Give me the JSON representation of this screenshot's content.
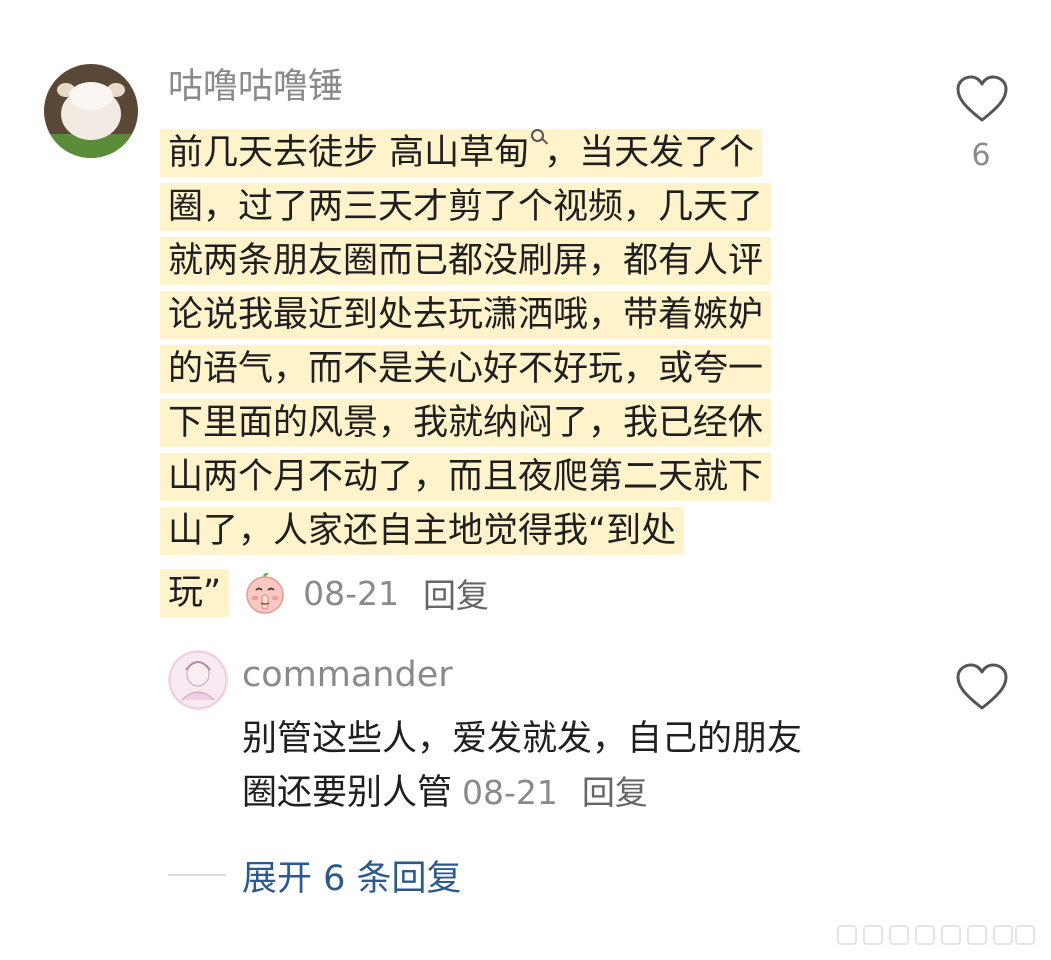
{
  "main_comment": {
    "username": "咕噜咕噜锤",
    "lines": [
      {
        "text": "前几天去徒步 "
      },
      {
        "text": "圈，过了两三天才剪了个视频，几天了"
      },
      {
        "text": "就两条朋友圈而已都没刷屏，都有人评"
      },
      {
        "text": "论说我最近到处去玩潇洒哦，带着嫉妒"
      },
      {
        "text": "的语气，而不是关心好不好玩，或夸一"
      },
      {
        "text": "下里面的风景，我就纳闷了，我已经休"
      },
      {
        "text": "山两个月不动了，而且夜爬第二天就下"
      },
      {
        "text": "山了，人家还自主地觉得我“到处"
      }
    ],
    "search_keyword": "高山草甸",
    "line1_tail": "，当天发了个",
    "last_line": "玩”",
    "time": "08-21",
    "reply_label": "回复",
    "likes": "6"
  },
  "reply_comment": {
    "username": "commander",
    "line1": "别管这些人，爱发就发，自己的朋友",
    "line2": "圈还要别人管",
    "time": "08-21",
    "reply_label": "回复"
  },
  "expand_replies": {
    "label": "展开 6 条回复"
  },
  "icons": {
    "like": "heart-outline-icon",
    "search": "search-icon",
    "emoji": "shush-face-emoji"
  },
  "colors": {
    "highlight": "#fff3cc",
    "secondary_text": "#8a8a8a",
    "link": "#2c5a8c"
  }
}
